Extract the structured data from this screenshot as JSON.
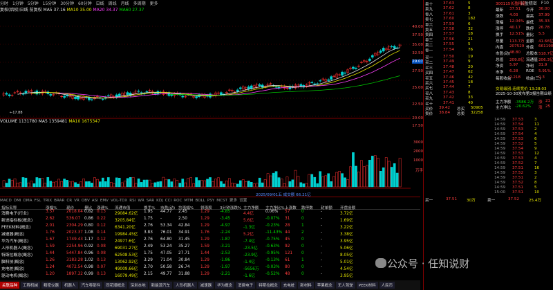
{
  "topbar": {
    "items": [
      "分时",
      "1分钟",
      "5分钟",
      "15分钟",
      "30分钟",
      "60分钟",
      "日线",
      "周线",
      "月线",
      "多周期",
      "更多"
    ],
    "right": "长盈精密",
    "f10": "F10"
  },
  "info": {
    "title": "复权(后权)日线 前复权",
    "ma5": "MA5 37.16",
    "ma10": "MA10 35.00",
    "ma20": "MA20 34.37",
    "ma60": "MA60 27.37"
  },
  "kline": {
    "yticks": [
      "40.00",
      "37.50",
      "35.00",
      "32.50",
      "30.00",
      "29.07",
      "27.50",
      "25.00",
      "22.50",
      "20.00",
      "17.50"
    ],
    "low": "17.88"
  },
  "volume": {
    "label": "VOLUME 1131780",
    "ma5": "MA5 1359481",
    "ma10": "MA10 1675347",
    "yticks": [
      "3000",
      "2000",
      "1000",
      "万手"
    ]
  },
  "tabs": {
    "items": [
      "MACD",
      "DMI",
      "DMA",
      "FSL",
      "TRIX",
      "BRAR",
      "CR",
      "VR",
      "OBV",
      "ASI",
      "EMV",
      "VOL-TDX",
      "RSI",
      "WR",
      "SAR",
      "KDJ",
      "CCI",
      "ROC",
      "MTM",
      "BOLL",
      "PSY",
      "MCST",
      "更多",
      "设置"
    ],
    "note": "2025/09/01五 成交额 66.21亿"
  },
  "table": {
    "headers": [
      "指标名称",
      "涨幅%",
      "现价",
      "量比",
      "涨速%",
      "流通市值",
      "换手%",
      "市盈(动)",
      "均涨幅%",
      "领涨股",
      "3分钟涨跌%",
      "主力净额",
      "主力净比%",
      "上涨数",
      "跌停数",
      "封单额",
      "开盘金额"
    ],
    "rows": [
      [
        "消费电子(行业)",
        "3.57",
        "2018.04",
        "0.82",
        "0.13",
        "29084.62亿",
        "1.95",
        "44.77",
        "2.45",
        "1.29",
        "-4.85",
        "4.4亿",
        "0.06%",
        "57",
        "0",
        "-",
        "3.72亿"
      ],
      [
        "新进指标板(概念)",
        "2.62",
        "536.07",
        "0.86",
        "0.22",
        "3205.84亿",
        "1.75",
        "-",
        "2.50",
        "1.29",
        "-3.45",
        "5.6亿",
        "-0.07%",
        "31",
        "0",
        "-",
        "1.69亿"
      ],
      [
        "PEEK材料(概念)",
        "2.01",
        "2304.29",
        "0.80",
        "0.12",
        "6341.20亿",
        "2.76",
        "53.34",
        "42.84",
        "1.29",
        "-4.97",
        "-1.3亿",
        "-0.23%",
        "28",
        "1",
        "-",
        "3.22亿"
      ],
      [
        "减速器(概念)",
        "1.76",
        "2023.37",
        "1.08",
        "0.14",
        "19984.45亿",
        "3.83",
        "76.01",
        "34.91",
        "1.76",
        "-2.24",
        "5.2亿",
        "-11.43%",
        "44",
        "2",
        "-",
        "3.38亿"
      ],
      [
        "华为汽车(概念)",
        "1.67",
        "1749.43",
        "1.17",
        "0.12",
        "24977.6亿",
        "2.76",
        "64.80",
        "31.45",
        "1.29",
        "-1.87",
        "-7.4亿",
        "-0.75%",
        "45",
        "0",
        "-",
        "3.95亿"
      ],
      [
        "人形机器人(概念)",
        "1.59",
        "2254.96",
        "0.92",
        "0.08",
        "69031.27亿",
        "2.49",
        "53.24",
        "35.27",
        "1.59",
        "-3.21",
        "-23.5亿",
        "-0.63%",
        "92",
        "0",
        "-",
        "5.06亿"
      ],
      [
        "特斯拉概念(概念)",
        "1.44",
        "5447.84",
        "0.96",
        "0.08",
        "62508.53亿",
        "1.75",
        "47.05",
        "27.71",
        "1.44",
        "-2.53",
        "-23.9亿",
        "-0.95%",
        "121",
        "0",
        "-",
        "8.05亿"
      ],
      [
        "脑科技(概念)",
        "1.26",
        "3183.28",
        "1.02",
        "0.13",
        "13062.92亿",
        "3.29",
        "71.04",
        "30.84",
        "1.29",
        "-1.86",
        "-1.4亿",
        "-0.13%",
        "61",
        "1",
        "-",
        "5.01亿"
      ],
      [
        "充电桩(概念)",
        "1.24",
        "4072.54",
        "0.98",
        "0.07",
        "49009.66亿",
        "2.70",
        "50.58",
        "26.74",
        "1.29",
        "-1.97",
        "-5656万",
        "-0.03%",
        "80",
        "0",
        "-",
        "4.54亿"
      ],
      [
        "驱动电机(概念)",
        "1.20",
        "1897.32",
        "0.99",
        "0.13",
        "16079.49亿",
        "2.15",
        "49.77",
        "31.88",
        "1.29",
        "-2.21",
        "-1.6亿",
        "-0.52%",
        "48",
        "0",
        "-",
        "3.95亿"
      ]
    ]
  },
  "bottombar": [
    "关联品种",
    "工程机械",
    "精密仪器",
    "机器人",
    "汽车零部件",
    "同花顺概念",
    "深圳本地",
    "新能源汽车",
    "人形机器人",
    "减速器",
    "华为概念",
    "消费电子",
    "特斯拉概念",
    "充电桩",
    "新材料",
    "苹果概念",
    "无人驾驶",
    "PEEK材料",
    "人民币"
  ],
  "stock": {
    "code": "300115",
    "name": "长盈精密",
    "sells": [
      [
        "卖十",
        "37.63",
        "5"
      ],
      [
        "卖九",
        "37.62",
        "8"
      ],
      [
        "卖八",
        "37.61",
        "3"
      ],
      [
        "卖七",
        "37.60",
        "182"
      ],
      [
        "卖六",
        "37.59",
        "6"
      ],
      [
        "卖五",
        "37.58",
        "32"
      ],
      [
        "卖四",
        "37.57",
        "18"
      ],
      [
        "卖三",
        "37.56",
        "21"
      ],
      [
        "卖二",
        "37.55",
        "5"
      ],
      [
        "卖一",
        "37.54",
        "76"
      ]
    ],
    "buys": [
      [
        "买一",
        "37.50",
        "19"
      ],
      [
        "买二",
        "37.49",
        "9"
      ],
      [
        "买三",
        "37.48",
        "20"
      ],
      [
        "买四",
        "37.47",
        "62"
      ],
      [
        "买五",
        "37.46",
        "42"
      ],
      [
        "买六",
        "37.45",
        "18"
      ],
      [
        "买七",
        "37.44",
        "7"
      ],
      [
        "买八",
        "37.43",
        "8"
      ],
      [
        "买九",
        "37.42",
        "33"
      ],
      [
        "买十",
        "37.41",
        "40"
      ]
    ],
    "stats": [
      [
        "最新",
        "37.51",
        "今开",
        "36.00"
      ],
      [
        "涨跌",
        "4.03",
        "最高",
        "37.99"
      ],
      [
        "涨幅",
        "12.04%",
        "最低",
        "35.33"
      ],
      [
        "涨停",
        "40.17",
        "跌停",
        "26.78"
      ],
      [
        "换手",
        "12.51%",
        "量比",
        "5.5"
      ],
      [
        "总量",
        "113.7万",
        "金额",
        "41.66亿"
      ],
      [
        "内盘",
        "207529",
        "外盘",
        "661190"
      ],
      [
        "市盈(动)",
        "48.80",
        "总股本",
        "518.7亿"
      ],
      [
        "总值",
        "209.8亿",
        "流通值",
        "206.3亿"
      ],
      [
        "净资",
        "5.97",
        "净利",
        "31.9"
      ],
      [
        "市净",
        "6.28",
        "ROE",
        "5.91%"
      ],
      [
        "每股收益",
        "0.218",
        "收益(三)",
        "0.3"
      ]
    ],
    "fund": "交易级别:连续竞价 13:28:03",
    "report": "2025-10-30发布第3报告期业绩",
    "flow": [
      "主力净额",
      "-3586.2万",
      "涨",
      "21"
    ],
    "flow2": [
      "主力净比",
      "-20.62%",
      "涨",
      "25"
    ],
    "bids": [
      [
        "买价",
        "39.42",
        "总买",
        "50905"
      ],
      [
        "卖价",
        "38.84",
        "总卖",
        "32258"
      ]
    ],
    "ticks": [
      [
        "14:59",
        "37.53",
        "3"
      ],
      [
        "14:59",
        "37.54",
        "11"
      ],
      [
        "14:59",
        "37.53",
        "2"
      ],
      [
        "14:59",
        "37.54",
        "4"
      ],
      [
        "14:59",
        "37.53",
        "6"
      ],
      [
        "14:59",
        "37.52",
        "5"
      ],
      [
        "14:59",
        "37.54",
        "9"
      ],
      [
        "14:59",
        "37.53",
        "12"
      ],
      [
        "14:59",
        "37.53",
        "4"
      ],
      [
        "14:59",
        "37.52",
        "7"
      ],
      [
        "14:59",
        "37.51",
        "16"
      ],
      [
        "14:59",
        "37.52",
        "3"
      ],
      [
        "14:59",
        "37.51",
        "2"
      ],
      [
        "14:59",
        "37.52",
        "8"
      ],
      [
        "14:59",
        "37.51",
        "5"
      ],
      [
        "15:00",
        "37.51",
        "10"
      ]
    ],
    "bottom": [
      "买一",
      "37.51",
      "30万",
      "卖一",
      "37.52",
      "25.4万"
    ]
  },
  "watermark": "公众号 · 任知说财"
}
